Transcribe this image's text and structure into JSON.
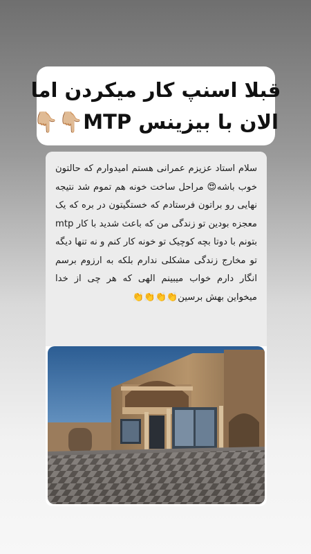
{
  "headline": {
    "line1": "قبلا اسنپ کار میکردن اما",
    "line2": "الان با بیزینس MTP👇🏼👇🏼"
  },
  "post": {
    "body_text": "سلام استاد عزیزم عمرانی هستم امیدوارم که حالتون خوب باشه😍 مراحل ساخت خونه هم تموم شد نتیجه نهایی رو براتون فرستادم که خستگیتون در بره که یک معجزه بودین تو زندگی من که باعث شدید با کار mtp بتونم با دوتا بچه کوچیک تو خونه کار کنم و نه تنها دیگه تو مخارج زندگی مشکلی ندارم بلکه به ارزوم برسم انگار دارم خواب میبینم الهی که هر چی از خدا میخواین بهش برسین👏👏👏👏"
  },
  "photo": {
    "subject": "new-stone-house"
  }
}
